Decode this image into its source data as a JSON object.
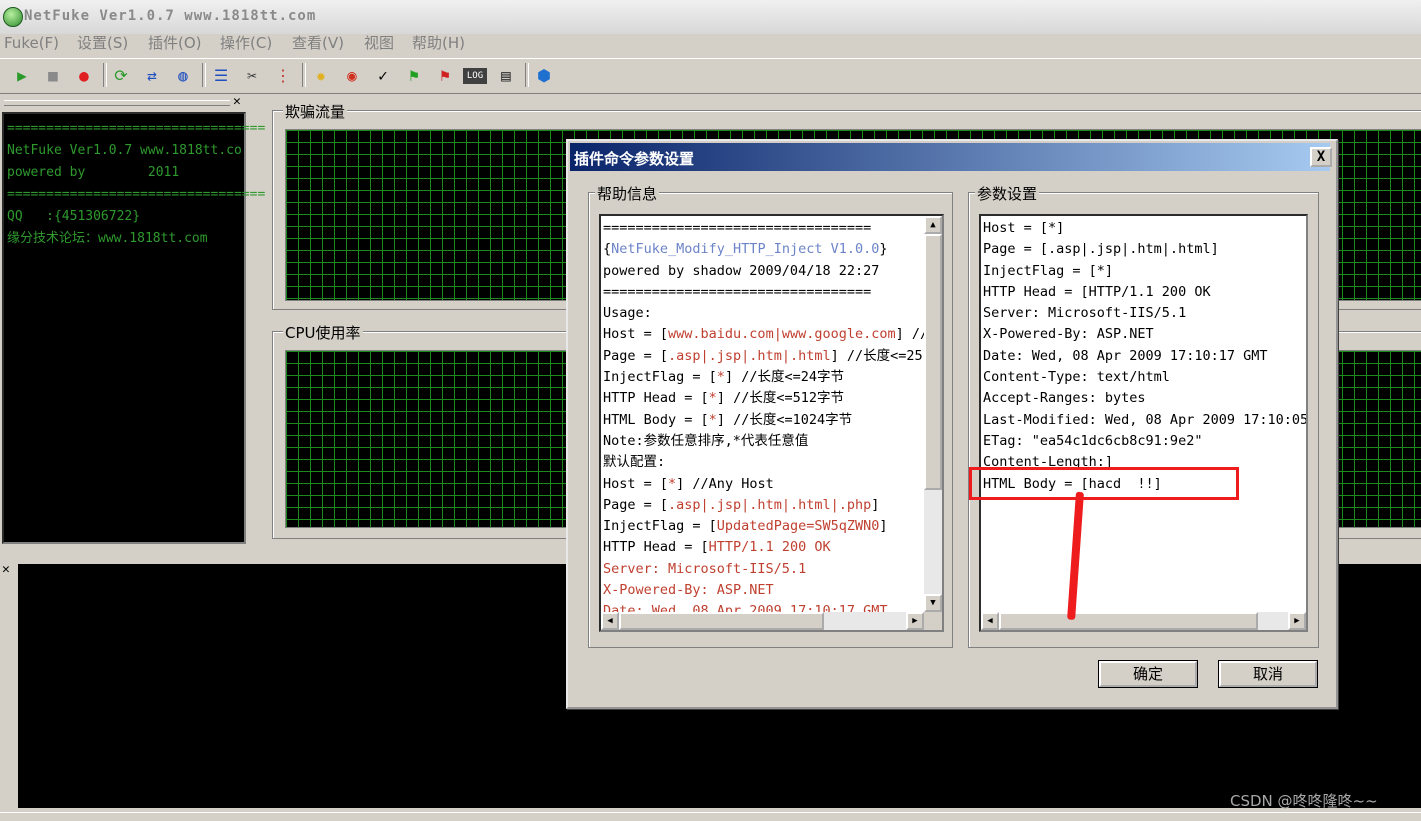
{
  "window": {
    "title": "NetFuke Ver1.0.7 www.1818tt.com"
  },
  "menu": {
    "items": [
      "Fuke(F)",
      "设置(S)",
      "插件(O)",
      "操作(C)",
      "查看(V)",
      "视图",
      "帮助(H)"
    ]
  },
  "toolbar": {
    "icons": [
      "play-icon",
      "stop-icon",
      "record-icon",
      "refresh-icon",
      "swap-icon",
      "globe-settings-icon",
      "list-icon",
      "cut-icon",
      "grid-icon",
      "sun-icon",
      "browser-icon",
      "check-icon",
      "flag-green-icon",
      "flag-red-icon",
      "log-icon",
      "notes-icon",
      "network-icon"
    ],
    "glyphs": [
      "▶",
      "■",
      "●",
      "⟳",
      "⇄",
      "◍",
      "☰",
      "✂",
      "⋮",
      "✹",
      "◉",
      "✓",
      "⚑",
      "⚑",
      "LOG",
      "▤",
      "⬢"
    ],
    "colors": {
      "play": "#2a9a2a",
      "stop": "#8a8a8a",
      "record": "#e02020",
      "accent": "#2050c0",
      "flag_red": "#d02020",
      "flag_green": "#20a020",
      "sun": "#e0b020"
    }
  },
  "left_panel": {
    "lines": [
      "=================================",
      "NetFuke Ver1.0.7 www.1818tt.co",
      "powered by        2011",
      "=================================",
      "QQ   :{451306722}",
      "缘分技术论坛：www.1818tt.com"
    ]
  },
  "panels": {
    "traffic_label": "欺骗流量",
    "cpu_label": "CPU使用率"
  },
  "dialog": {
    "title": "插件命令参数设置",
    "close_label": "X",
    "help": {
      "label": "帮助信息",
      "lines": [
        [
          {
            "t": "================================="
          }
        ],
        [
          {
            "t": "{"
          },
          {
            "t": "NetFuke_Modify_HTTP_Inject V1.0.0",
            "c": "blue"
          },
          {
            "t": "}"
          }
        ],
        [
          {
            "t": "powered by shadow 2009/04/18 22:27"
          }
        ],
        [
          {
            "t": "================================="
          }
        ],
        [
          {
            "t": "Usage:"
          }
        ],
        [
          {
            "t": "Host = ["
          },
          {
            "t": "www.baidu.com|www.google.com",
            "c": "red"
          },
          {
            "t": "] //"
          }
        ],
        [
          {
            "t": "Page = ["
          },
          {
            "t": ".asp|.jsp|.htm|.html",
            "c": "red"
          },
          {
            "t": "] //长度<=25"
          }
        ],
        [
          {
            "t": "InjectFlag = ["
          },
          {
            "t": "*",
            "c": "red"
          },
          {
            "t": "] //长度<=24字节"
          }
        ],
        [
          {
            "t": "HTTP Head = ["
          },
          {
            "t": "*",
            "c": "red"
          },
          {
            "t": "] //长度<=512字节"
          }
        ],
        [
          {
            "t": "HTML Body = ["
          },
          {
            "t": "*",
            "c": "red"
          },
          {
            "t": "] //长度<=1024字节"
          }
        ],
        [
          {
            "t": "Note:参数任意排序,*代表任意值"
          }
        ],
        [
          {
            "t": "默认配置:"
          }
        ],
        [
          {
            "t": "Host = ["
          },
          {
            "t": "*",
            "c": "red"
          },
          {
            "t": "] //Any Host"
          }
        ],
        [
          {
            "t": "Page = ["
          },
          {
            "t": ".asp|.jsp|.htm|.html|.php",
            "c": "red"
          },
          {
            "t": "]"
          }
        ],
        [
          {
            "t": "InjectFlag = ["
          },
          {
            "t": "UpdatedPage=SW5qZWN0",
            "c": "red"
          },
          {
            "t": "]"
          }
        ],
        [
          {
            "t": "HTTP Head = ["
          },
          {
            "t": "HTTP/1.1 200 OK",
            "c": "red"
          }
        ],
        [
          {
            "t": "Server: Microsoft-IIS/5.1",
            "c": "red"
          }
        ],
        [
          {
            "t": "X-Powered-By: ASP.NET",
            "c": "red"
          }
        ],
        [
          {
            "t": "Date: Wed, 08 Apr 2009 17:10:17 GMT",
            "c": "red"
          }
        ]
      ]
    },
    "params": {
      "label": "参数设置",
      "lines": [
        "Host = [*]",
        "Page = [.asp|.jsp|.htm|.html]",
        "InjectFlag = [*]",
        "HTTP Head = [HTTP/1.1 200 OK",
        "Server: Microsoft-IIS/5.1",
        "X-Powered-By: ASP.NET",
        "Date: Wed, 08 Apr 2009 17:10:17 GMT",
        "Content-Type: text/html",
        "Accept-Ranges: bytes",
        "Last-Modified: Wed, 08 Apr 2009 17:10:05",
        "ETag: \"ea54c1dc6cb8c91:9e2\"",
        "Content-Length:]",
        "HTML Body = [hacd  !!]"
      ]
    },
    "ok_label": "确定",
    "cancel_label": "取消"
  },
  "annotation": {
    "color": "#ee1c1c"
  },
  "watermark": "CSDN @咚咚隆咚~~"
}
